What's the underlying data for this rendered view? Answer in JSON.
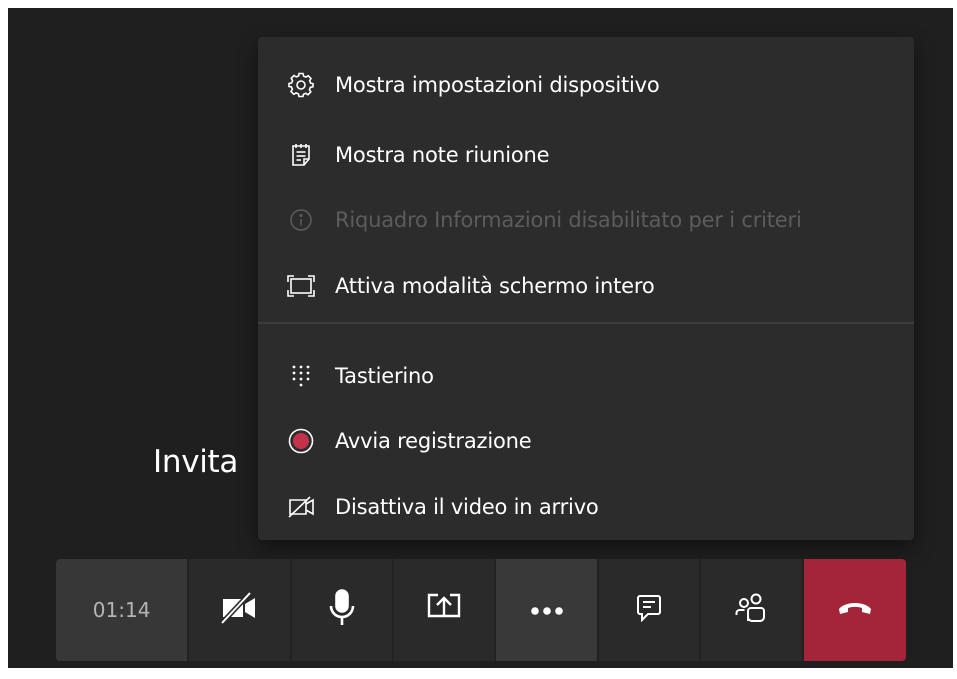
{
  "stage": {
    "caption": "Invita"
  },
  "menu": {
    "items": [
      {
        "label": "Mostra impostazioni dispositivo",
        "icon": "gear-icon",
        "enabled": true
      },
      {
        "label": "Mostra note riunione",
        "icon": "notes-icon",
        "enabled": true
      },
      {
        "label": "Riquadro Informazioni disabilitato per i criteri",
        "icon": "info-icon",
        "enabled": false
      },
      {
        "label": "Attiva modalità schermo intero",
        "icon": "fullscreen-icon",
        "enabled": true
      },
      {
        "label": "Tastierino",
        "icon": "dialpad-icon",
        "enabled": true
      },
      {
        "label": "Avvia registrazione",
        "icon": "record-icon",
        "enabled": true
      },
      {
        "label": "Disattiva il video in arrivo",
        "icon": "video-off-icon",
        "enabled": true
      }
    ]
  },
  "toolbar": {
    "timer": "01:14",
    "buttons": [
      "camera-off-icon",
      "microphone-icon",
      "share-screen-icon",
      "more-options-icon",
      "chat-icon",
      "participants-icon",
      "hang-up-icon"
    ]
  },
  "colors": {
    "background": "#1f1f1f",
    "menu": "#2d2c2c",
    "toolbar": "#2b2a2a",
    "hangup": "#a4253a",
    "record": "#c4314b",
    "disabled_text": "#5d5c5c"
  }
}
